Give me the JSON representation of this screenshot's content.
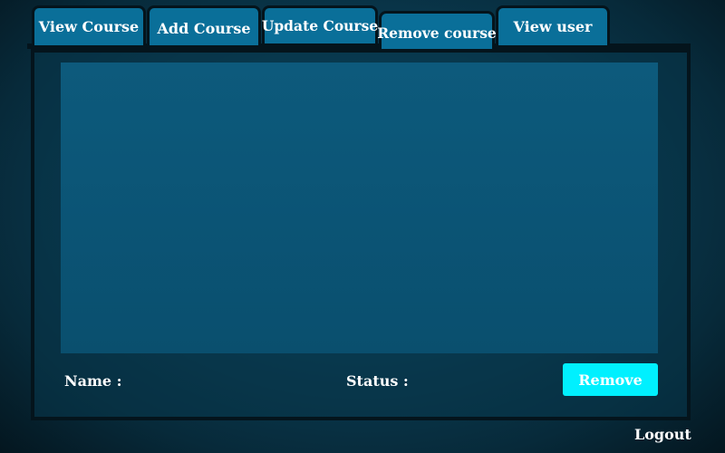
{
  "tabs": [
    {
      "label": "View Course"
    },
    {
      "label": "Add Course"
    },
    {
      "label": "Update Course"
    },
    {
      "label": "Remove course",
      "selected": true
    },
    {
      "label": "View user"
    }
  ],
  "form": {
    "name_label": "Name :",
    "status_label": "Status :",
    "remove_label": "Remove"
  },
  "footer": {
    "logout_label": "Logout"
  },
  "colors": {
    "tab_bg": "#0a6f99",
    "remove_button": "#00f0ff"
  }
}
